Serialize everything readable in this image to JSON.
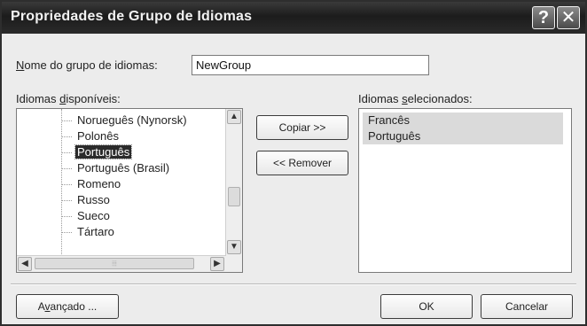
{
  "window": {
    "title": "Propriedades de Grupo de Idiomas",
    "help_glyph": "?",
    "close_glyph": "✕"
  },
  "group_name": {
    "label_first": "N",
    "label_rest": "ome do grupo de idiomas:",
    "value": "NewGroup"
  },
  "available": {
    "label_pre": "Idiomas ",
    "label_access": "d",
    "label_post": "isponíveis:",
    "items": [
      "Norueguês (Nynorsk)",
      "Polonês",
      "Português",
      "Português (Brasil)",
      "Romeno",
      "Russo",
      "Sueco",
      "Tártaro"
    ],
    "selected_index": 2,
    "scroll_up": "▲",
    "scroll_down": "▼",
    "scroll_left": "◀",
    "scroll_right": "▶",
    "grip": "⦙⦙⦙"
  },
  "actions": {
    "copy": "Copiar >>",
    "remove": "<< Remover"
  },
  "selected": {
    "label_pre": "Idiomas ",
    "label_access": "s",
    "label_post": "elecionados:",
    "items": [
      "Francês",
      "Português"
    ]
  },
  "footer": {
    "advanced_first": "A",
    "advanced_access": "v",
    "advanced_rest": "ançado ...",
    "ok": "OK",
    "cancel": "Cancelar"
  }
}
